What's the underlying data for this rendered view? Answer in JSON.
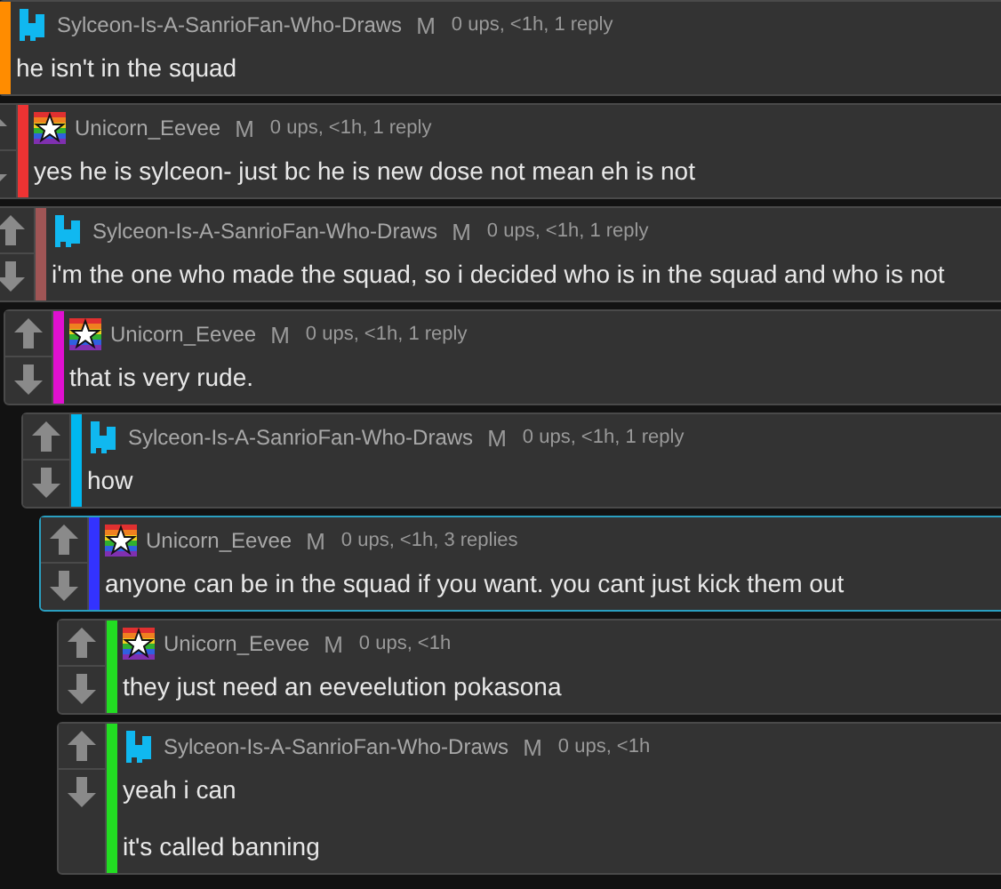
{
  "comments": [
    {
      "avatar": {
        "kind": "cyan-figure"
      },
      "user": "Sylceon-Is-A-SanrioFan-Who-Draws",
      "badge": "M",
      "meta": "0 ups, <1h, 1 reply",
      "color": "#ff8c00",
      "highlighted": false,
      "paragraphs": [
        "he isn't in the squad"
      ],
      "replies": [
        {
          "avatar": {
            "kind": "rainbow-star"
          },
          "user": "Unicorn_Eevee",
          "badge": "M",
          "meta": "0 ups, <1h, 1 reply",
          "color": "#ee3333",
          "highlighted": false,
          "paragraphs": [
            "yes he is sylceon- just bc he is new dose not mean eh is not"
          ],
          "replies": [
            {
              "avatar": {
                "kind": "cyan-figure"
              },
              "user": "Sylceon-Is-A-SanrioFan-Who-Draws",
              "badge": "M",
              "meta": "0 ups, <1h, 1 reply",
              "color": "#a05555",
              "highlighted": false,
              "paragraphs": [
                "i'm the one who made the squad, so i decided who is in the squad and who is not"
              ],
              "replies": [
                {
                  "avatar": {
                    "kind": "rainbow-star"
                  },
                  "user": "Unicorn_Eevee",
                  "badge": "M",
                  "meta": "0 ups, <1h, 1 reply",
                  "color": "#e010d0",
                  "highlighted": false,
                  "paragraphs": [
                    "that is very rude."
                  ],
                  "replies": [
                    {
                      "avatar": {
                        "kind": "cyan-figure"
                      },
                      "user": "Sylceon-Is-A-SanrioFan-Who-Draws",
                      "badge": "M",
                      "meta": "0 ups, <1h, 1 reply",
                      "color": "#00b8f0",
                      "highlighted": false,
                      "paragraphs": [
                        "how"
                      ],
                      "replies": [
                        {
                          "avatar": {
                            "kind": "rainbow-star"
                          },
                          "user": "Unicorn_Eevee",
                          "badge": "M",
                          "meta": "0 ups, <1h, 3 replies",
                          "color": "#3333ff",
                          "highlighted": true,
                          "paragraphs": [
                            "anyone can be in the squad if you want. you cant just kick them out"
                          ],
                          "replies": [
                            {
                              "avatar": {
                                "kind": "rainbow-star"
                              },
                              "user": "Unicorn_Eevee",
                              "badge": "M",
                              "meta": "0 ups, <1h",
                              "color": "#22dd22",
                              "highlighted": false,
                              "paragraphs": [
                                "they just need an eeveelution pokasona"
                              ]
                            },
                            {
                              "avatar": {
                                "kind": "cyan-figure"
                              },
                              "user": "Sylceon-Is-A-SanrioFan-Who-Draws",
                              "badge": "M",
                              "meta": "0 ups, <1h",
                              "color": "#22dd22",
                              "highlighted": false,
                              "paragraphs": [
                                "yeah i can",
                                "it's called banning"
                              ]
                            }
                          ]
                        }
                      ]
                    }
                  ]
                }
              ]
            }
          ]
        }
      ]
    }
  ]
}
